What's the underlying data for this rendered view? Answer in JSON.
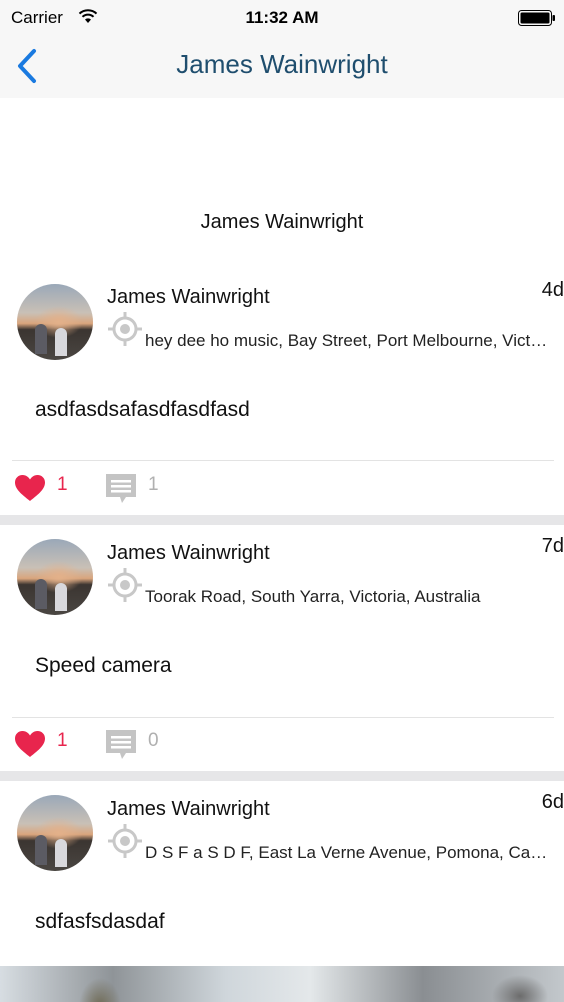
{
  "status_bar": {
    "carrier": "Carrier",
    "time": "11:32 AM"
  },
  "nav": {
    "title": "James Wainwright",
    "accent_color": "#1a7ae0",
    "title_color": "#1f4e6e"
  },
  "profile": {
    "name": "James Wainwright"
  },
  "posts": [
    {
      "author": "James Wainwright",
      "age": "4d",
      "location": "hey dee ho music, Bay Street, Port Melbourne, Victoria, Australia",
      "body": "asdfasdsafasdfasdfasd",
      "likes": "1",
      "comments": "1"
    },
    {
      "author": "James Wainwright",
      "age": "7d",
      "location": "Toorak Road, South Yarra, Victoria, Australia",
      "body": "Speed camera",
      "likes": "1",
      "comments": "0"
    },
    {
      "author": "James Wainwright",
      "age": "6d",
      "location": "D S F a S D F, East La Verne Avenue, Pomona, California",
      "body": "sdfasfsdasdaf"
    }
  ],
  "colors": {
    "like": "#e8254d",
    "comment": "#b0b0b0",
    "separator": "#e6e6e8"
  }
}
